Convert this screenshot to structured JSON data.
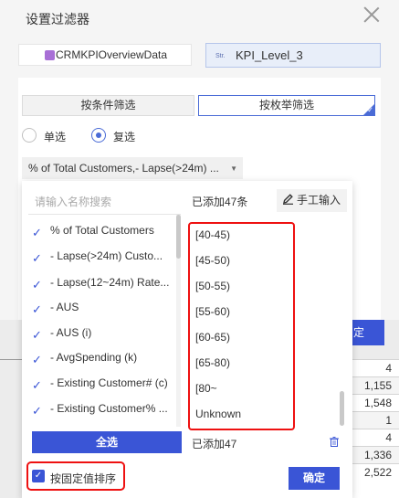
{
  "dialog": {
    "title": "设置过滤器"
  },
  "datasource": {
    "left_label": "CRMKPIOverviewData",
    "right_type_tag": "Str.",
    "right_label": "KPI_Level_3"
  },
  "mode_tabs": [
    {
      "label": "按条件筛选",
      "active": false
    },
    {
      "label": "按枚举筛选",
      "active": true
    }
  ],
  "selection_mode": {
    "single_label": "单选",
    "multi_label": "复选",
    "selected": "复选"
  },
  "field_select": {
    "value": "% of Total Customers,- Lapse(>24m) ..."
  },
  "search": {
    "placeholder": "请输入名称搜索"
  },
  "left_list": {
    "items": [
      {
        "label": "% of Total Customers",
        "checked": true
      },
      {
        "label": "- Lapse(>24m) Custo...",
        "checked": true
      },
      {
        "label": "- Lapse(12~24m) Rate...",
        "checked": true
      },
      {
        "label": "- AUS",
        "checked": true
      },
      {
        "label": "- AUS (i)",
        "checked": true
      },
      {
        "label": "- AvgSpending (k)",
        "checked": true
      },
      {
        "label": "- Existing Customer# (c)",
        "checked": true
      },
      {
        "label": "- Existing Customer% ...",
        "checked": true
      }
    ],
    "select_all_label": "全选"
  },
  "right_list": {
    "added_top": "已添加47条",
    "manual_input_label": "手工输入",
    "values": [
      "[40-45)",
      "[45-50)",
      "[50-55)",
      "[55-60)",
      "[60-65)",
      "[65-80)",
      "[80~",
      "Unknown"
    ],
    "added_bottom": "已添加47"
  },
  "footer": {
    "sort_label": "按固定值排序",
    "sort_checked": true,
    "confirm_label": "确定"
  },
  "background": {
    "peek_button_label": "定",
    "table_values": [
      "4",
      "1,155",
      "1,548",
      "1",
      "4",
      "1,336",
      "2,522"
    ]
  },
  "colors": {
    "accent": "#3a55d6",
    "highlight": "#e11111"
  }
}
